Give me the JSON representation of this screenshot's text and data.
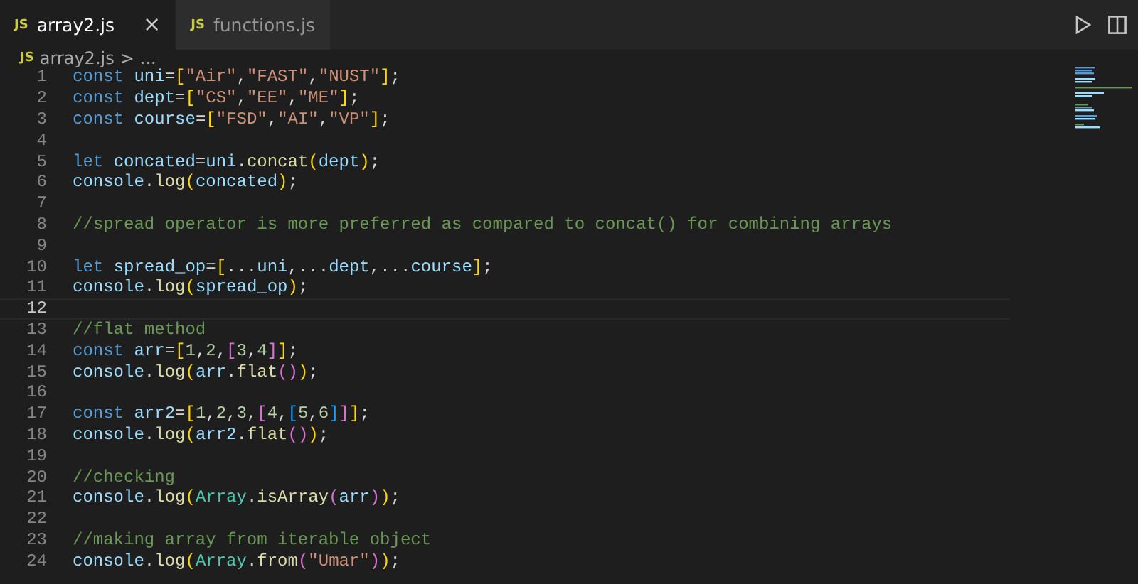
{
  "tabs": [
    {
      "icon": "JS",
      "label": "array2.js",
      "selected": true,
      "close": "×"
    },
    {
      "icon": "JS",
      "label": "functions.js",
      "selected": false
    }
  ],
  "breadcrumb": {
    "icon": "JS",
    "file": "array2.js",
    "separator": ">",
    "more": "..."
  },
  "lines": [
    {
      "number": "1",
      "current": false,
      "tokens": [
        {
          "text": "const ",
          "kind": "kw"
        },
        {
          "text": "uni",
          "kind": "var"
        },
        {
          "text": "=",
          "kind": "punct"
        },
        {
          "text": "[",
          "kind": "b1"
        },
        {
          "text": "\"Air\"",
          "kind": "str"
        },
        {
          "text": ",",
          "kind": "punct"
        },
        {
          "text": "\"FAST\"",
          "kind": "str"
        },
        {
          "text": ",",
          "kind": "punct"
        },
        {
          "text": "\"NUST\"",
          "kind": "str"
        },
        {
          "text": "]",
          "kind": "b1"
        },
        {
          "text": ";",
          "kind": "punct"
        }
      ]
    },
    {
      "number": "2",
      "current": false,
      "tokens": [
        {
          "text": "const ",
          "kind": "kw"
        },
        {
          "text": "dept",
          "kind": "var"
        },
        {
          "text": "=",
          "kind": "punct"
        },
        {
          "text": "[",
          "kind": "b1"
        },
        {
          "text": "\"CS\"",
          "kind": "str"
        },
        {
          "text": ",",
          "kind": "punct"
        },
        {
          "text": "\"EE\"",
          "kind": "str"
        },
        {
          "text": ",",
          "kind": "punct"
        },
        {
          "text": "\"ME\"",
          "kind": "str"
        },
        {
          "text": "]",
          "kind": "b1"
        },
        {
          "text": ";",
          "kind": "punct"
        }
      ]
    },
    {
      "number": "3",
      "current": false,
      "tokens": [
        {
          "text": "const ",
          "kind": "kw"
        },
        {
          "text": "course",
          "kind": "var"
        },
        {
          "text": "=",
          "kind": "punct"
        },
        {
          "text": "[",
          "kind": "b1"
        },
        {
          "text": "\"FSD\"",
          "kind": "str"
        },
        {
          "text": ",",
          "kind": "punct"
        },
        {
          "text": "\"AI\"",
          "kind": "str"
        },
        {
          "text": ",",
          "kind": "punct"
        },
        {
          "text": "\"VP\"",
          "kind": "str"
        },
        {
          "text": "]",
          "kind": "b1"
        },
        {
          "text": ";",
          "kind": "punct"
        }
      ]
    },
    {
      "number": "4",
      "current": false
    },
    {
      "number": "5",
      "current": false,
      "tokens": [
        {
          "text": "let ",
          "kind": "kw"
        },
        {
          "text": "concated",
          "kind": "var"
        },
        {
          "text": "=",
          "kind": "punct"
        },
        {
          "text": "uni",
          "kind": "var"
        },
        {
          "text": ".",
          "kind": "punct"
        },
        {
          "text": "concat",
          "kind": "fn"
        },
        {
          "text": "(",
          "kind": "b1"
        },
        {
          "text": "dept",
          "kind": "var"
        },
        {
          "text": ")",
          "kind": "b1"
        },
        {
          "text": ";",
          "kind": "punct"
        }
      ]
    },
    {
      "number": "6",
      "current": false,
      "tokens": [
        {
          "text": "console",
          "kind": "var"
        },
        {
          "text": ".",
          "kind": "punct"
        },
        {
          "text": "log",
          "kind": "fn"
        },
        {
          "text": "(",
          "kind": "b1"
        },
        {
          "text": "concated",
          "kind": "var"
        },
        {
          "text": ")",
          "kind": "b1"
        },
        {
          "text": ";",
          "kind": "punct"
        }
      ]
    },
    {
      "number": "7",
      "current": false
    },
    {
      "number": "8",
      "current": false,
      "tokens": [
        {
          "text": "//spread operator is more preferred as compared to concat() for combining arrays",
          "kind": "comment"
        }
      ]
    },
    {
      "number": "9",
      "current": false
    },
    {
      "number": "10",
      "current": false,
      "tokens": [
        {
          "text": "let ",
          "kind": "kw"
        },
        {
          "text": "spread_op",
          "kind": "var"
        },
        {
          "text": "=",
          "kind": "punct"
        },
        {
          "text": "[",
          "kind": "b1"
        },
        {
          "text": "...",
          "kind": "punct"
        },
        {
          "text": "uni",
          "kind": "var"
        },
        {
          "text": ",...",
          "kind": "punct"
        },
        {
          "text": "dept",
          "kind": "var"
        },
        {
          "text": ",...",
          "kind": "punct"
        },
        {
          "text": "course",
          "kind": "var"
        },
        {
          "text": "]",
          "kind": "b1"
        },
        {
          "text": ";",
          "kind": "punct"
        }
      ]
    },
    {
      "number": "11",
      "current": false,
      "tokens": [
        {
          "text": "console",
          "kind": "var"
        },
        {
          "text": ".",
          "kind": "punct"
        },
        {
          "text": "log",
          "kind": "fn"
        },
        {
          "text": "(",
          "kind": "b1"
        },
        {
          "text": "spread_op",
          "kind": "var"
        },
        {
          "text": ")",
          "kind": "b1"
        },
        {
          "text": ";",
          "kind": "punct"
        }
      ]
    },
    {
      "number": "12",
      "current": true
    },
    {
      "number": "13",
      "current": false,
      "tokens": [
        {
          "text": "//flat method",
          "kind": "comment"
        }
      ]
    },
    {
      "number": "14",
      "current": false,
      "tokens": [
        {
          "text": "const ",
          "kind": "kw"
        },
        {
          "text": "arr",
          "kind": "var"
        },
        {
          "text": "=",
          "kind": "punct"
        },
        {
          "text": "[",
          "kind": "b1"
        },
        {
          "text": "1",
          "kind": "num"
        },
        {
          "text": ",",
          "kind": "punct"
        },
        {
          "text": "2",
          "kind": "num"
        },
        {
          "text": ",",
          "kind": "punct"
        },
        {
          "text": "[",
          "kind": "b2"
        },
        {
          "text": "3",
          "kind": "num"
        },
        {
          "text": ",",
          "kind": "punct"
        },
        {
          "text": "4",
          "kind": "num"
        },
        {
          "text": "]",
          "kind": "b2"
        },
        {
          "text": "]",
          "kind": "b1"
        },
        {
          "text": ";",
          "kind": "punct"
        }
      ]
    },
    {
      "number": "15",
      "current": false,
      "tokens": [
        {
          "text": "console",
          "kind": "var"
        },
        {
          "text": ".",
          "kind": "punct"
        },
        {
          "text": "log",
          "kind": "fn"
        },
        {
          "text": "(",
          "kind": "b1"
        },
        {
          "text": "arr",
          "kind": "var"
        },
        {
          "text": ".",
          "kind": "punct"
        },
        {
          "text": "flat",
          "kind": "fn"
        },
        {
          "text": "()",
          "kind": "b2"
        },
        {
          "text": ")",
          "kind": "b1"
        },
        {
          "text": ";",
          "kind": "punct"
        }
      ]
    },
    {
      "number": "16",
      "current": false
    },
    {
      "number": "17",
      "current": false,
      "tokens": [
        {
          "text": "const ",
          "kind": "kw"
        },
        {
          "text": "arr2",
          "kind": "var"
        },
        {
          "text": "=",
          "kind": "punct"
        },
        {
          "text": "[",
          "kind": "b1"
        },
        {
          "text": "1",
          "kind": "num"
        },
        {
          "text": ",",
          "kind": "punct"
        },
        {
          "text": "2",
          "kind": "num"
        },
        {
          "text": ",",
          "kind": "punct"
        },
        {
          "text": "3",
          "kind": "num"
        },
        {
          "text": ",",
          "kind": "punct"
        },
        {
          "text": "[",
          "kind": "b2"
        },
        {
          "text": "4",
          "kind": "num"
        },
        {
          "text": ",",
          "kind": "punct"
        },
        {
          "text": "[",
          "kind": "b3"
        },
        {
          "text": "5",
          "kind": "num"
        },
        {
          "text": ",",
          "kind": "punct"
        },
        {
          "text": "6",
          "kind": "num"
        },
        {
          "text": "]",
          "kind": "b3"
        },
        {
          "text": "]",
          "kind": "b2"
        },
        {
          "text": "]",
          "kind": "b1"
        },
        {
          "text": ";",
          "kind": "punct"
        }
      ]
    },
    {
      "number": "18",
      "current": false,
      "tokens": [
        {
          "text": "console",
          "kind": "var"
        },
        {
          "text": ".",
          "kind": "punct"
        },
        {
          "text": "log",
          "kind": "fn"
        },
        {
          "text": "(",
          "kind": "b1"
        },
        {
          "text": "arr2",
          "kind": "var"
        },
        {
          "text": ".",
          "kind": "punct"
        },
        {
          "text": "flat",
          "kind": "fn"
        },
        {
          "text": "()",
          "kind": "b2"
        },
        {
          "text": ")",
          "kind": "b1"
        },
        {
          "text": ";",
          "kind": "punct"
        }
      ]
    },
    {
      "number": "19",
      "current": false
    },
    {
      "number": "20",
      "current": false,
      "tokens": [
        {
          "text": "//checking",
          "kind": "comment"
        }
      ]
    },
    {
      "number": "21",
      "current": false,
      "tokens": [
        {
          "text": "console",
          "kind": "var"
        },
        {
          "text": ".",
          "kind": "punct"
        },
        {
          "text": "log",
          "kind": "fn"
        },
        {
          "text": "(",
          "kind": "b1"
        },
        {
          "text": "Array",
          "kind": "cls"
        },
        {
          "text": ".",
          "kind": "punct"
        },
        {
          "text": "isArray",
          "kind": "fn"
        },
        {
          "text": "(",
          "kind": "b2"
        },
        {
          "text": "arr",
          "kind": "var"
        },
        {
          "text": ")",
          "kind": "b2"
        },
        {
          "text": ")",
          "kind": "b1"
        },
        {
          "text": ";",
          "kind": "punct"
        }
      ]
    },
    {
      "number": "22",
      "current": false
    },
    {
      "number": "23",
      "current": false,
      "tokens": [
        {
          "text": "//making array from iterable object",
          "kind": "comment"
        }
      ]
    },
    {
      "number": "24",
      "current": false,
      "tokens": [
        {
          "text": "console",
          "kind": "var"
        },
        {
          "text": ".",
          "kind": "punct"
        },
        {
          "text": "log",
          "kind": "fn"
        },
        {
          "text": "(",
          "kind": "b1"
        },
        {
          "text": "Array",
          "kind": "cls"
        },
        {
          "text": ".",
          "kind": "punct"
        },
        {
          "text": "from",
          "kind": "fn"
        },
        {
          "text": "(",
          "kind": "b2"
        },
        {
          "text": "\"Umar\"",
          "kind": "str"
        },
        {
          "text": ")",
          "kind": "b2"
        },
        {
          "text": ")",
          "kind": "b1"
        },
        {
          "text": ";",
          "kind": "punct"
        }
      ]
    }
  ]
}
